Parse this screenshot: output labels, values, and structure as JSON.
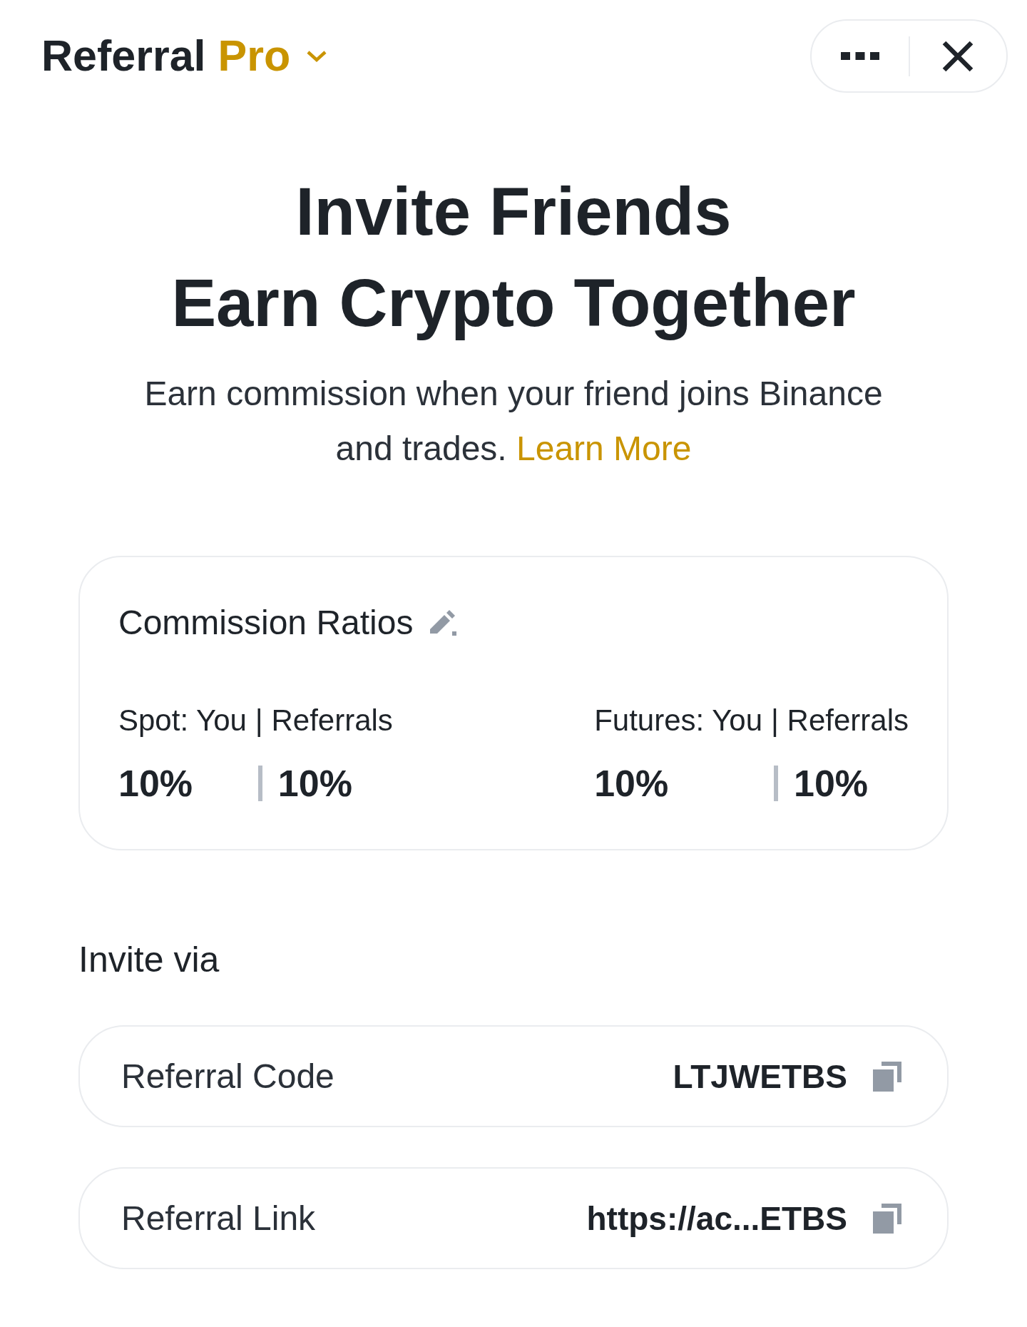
{
  "header": {
    "title": "Referral",
    "title_highlight": "Pro"
  },
  "hero": {
    "heading_lines": [
      "Invite Friends",
      "Earn Crypto Together"
    ],
    "description": "Earn commission when your friend joins Binance and trades.",
    "link": "Learn More"
  },
  "commission": {
    "title": "Commission Ratios",
    "groups": [
      {
        "you_label": "Spot: You",
        "referrals_label": "| Referrals",
        "you_value": "10%",
        "referrals_value": "10%"
      },
      {
        "you_label": "Futures: You",
        "referrals_label": "| Referrals",
        "you_value": "10%",
        "referrals_value": "10%"
      }
    ]
  },
  "invite": {
    "title": "Invite via",
    "rows": [
      {
        "label": "Referral Code",
        "value": "LTJWETBS"
      },
      {
        "label": "Referral Link",
        "value": "https://ac...ETBS"
      }
    ]
  }
}
